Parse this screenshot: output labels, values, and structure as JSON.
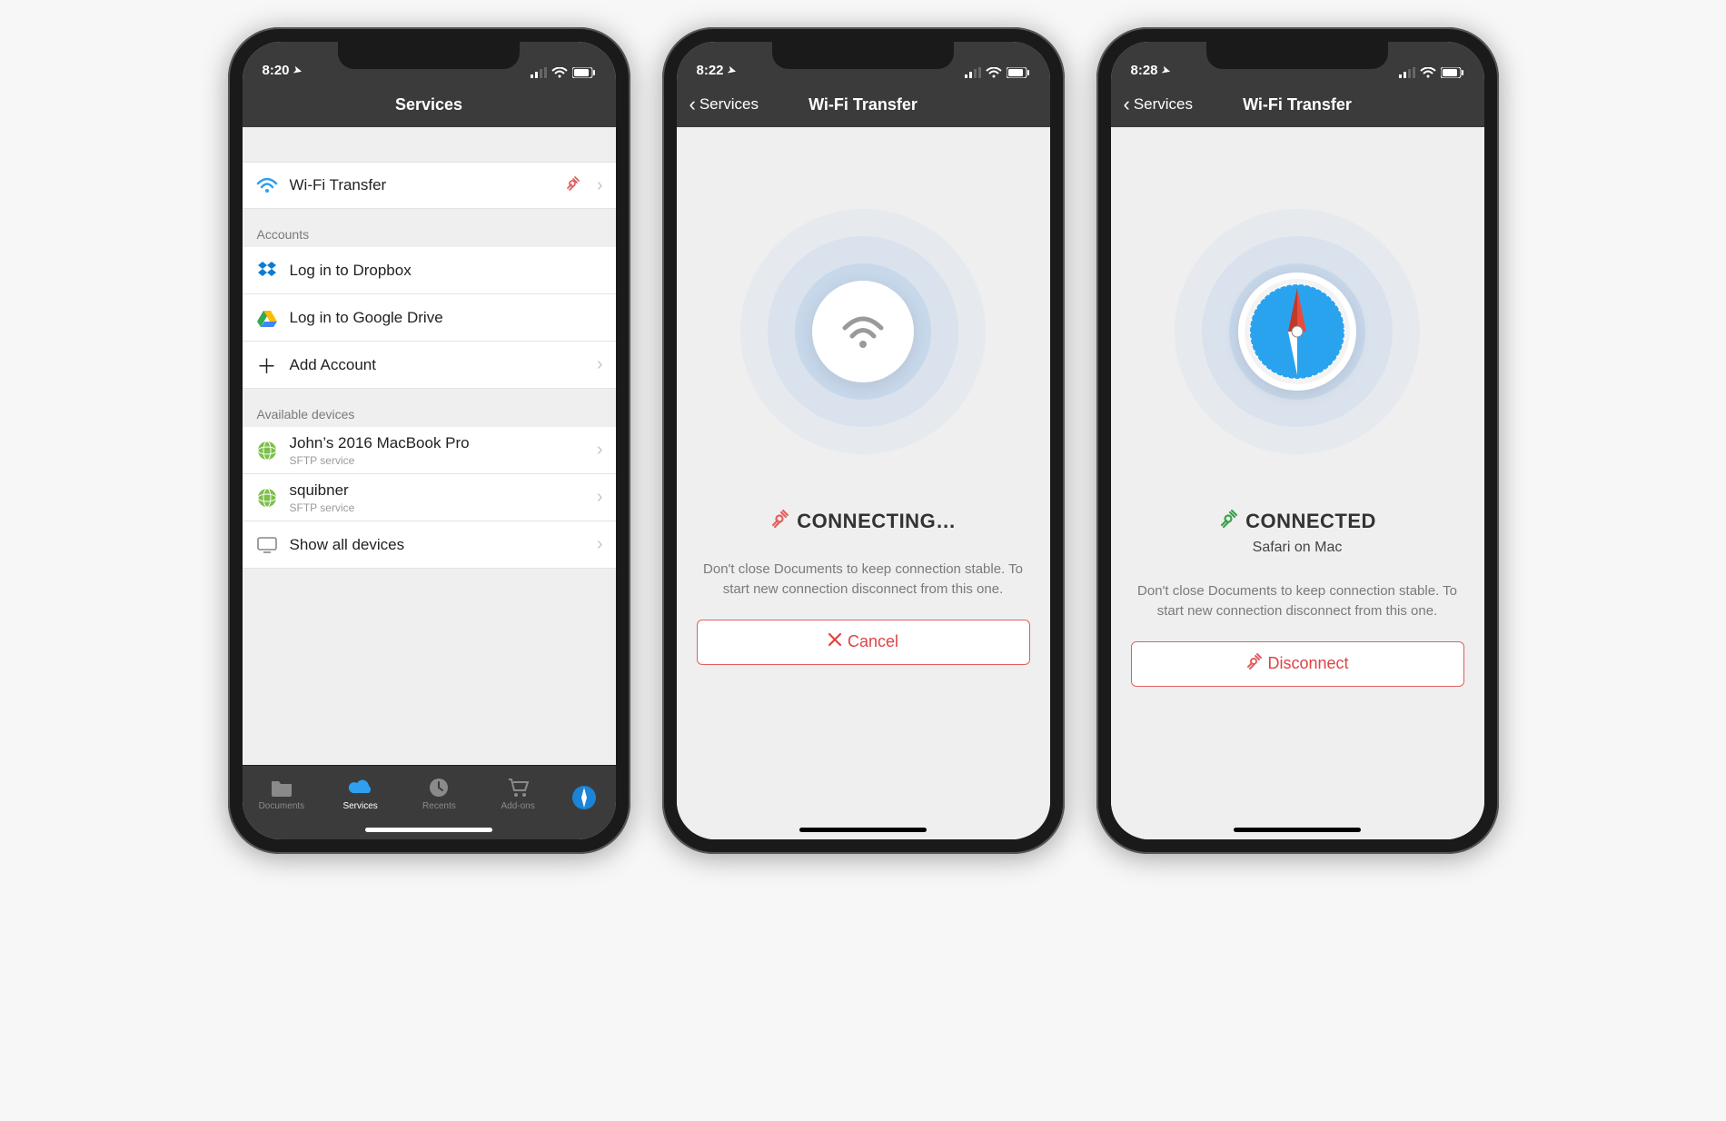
{
  "phones": [
    {
      "status": {
        "time": "8:20",
        "location_icon": true
      },
      "nav": {
        "title": "Services",
        "back": null
      },
      "groups": [
        {
          "header": null,
          "rows": [
            {
              "icon": "wifi",
              "label": "Wi-Fi Transfer",
              "sub": null,
              "trailing_icon": "plug",
              "chevron": true,
              "name": "row-wifi-transfer"
            }
          ]
        },
        {
          "header": "Accounts",
          "rows": [
            {
              "icon": "dropbox",
              "label": "Log in to Dropbox",
              "sub": null,
              "chevron": false,
              "name": "row-dropbox"
            },
            {
              "icon": "gdrive",
              "label": "Log in to Google Drive",
              "sub": null,
              "chevron": false,
              "name": "row-gdrive"
            },
            {
              "icon": "plus",
              "label": "Add Account",
              "sub": null,
              "chevron": true,
              "name": "row-add-account"
            }
          ]
        },
        {
          "header": "Available devices",
          "rows": [
            {
              "icon": "globe",
              "label": "John’s 2016 MacBook Pro",
              "sub": "SFTP service",
              "chevron": true,
              "name": "row-device-johns-mbp"
            },
            {
              "icon": "globe",
              "label": "squibner",
              "sub": "SFTP service",
              "chevron": true,
              "name": "row-device-squibner"
            },
            {
              "icon": "monitor",
              "label": "Show all devices",
              "sub": null,
              "chevron": true,
              "name": "row-show-all-devices"
            }
          ]
        }
      ],
      "tabs": [
        {
          "icon": "folder",
          "label": "Documents",
          "active": false,
          "name": "tab-documents"
        },
        {
          "icon": "cloud",
          "label": "Services",
          "active": true,
          "name": "tab-services"
        },
        {
          "icon": "clock",
          "label": "Recents",
          "active": false,
          "name": "tab-recents"
        },
        {
          "icon": "cart",
          "label": "Add-ons",
          "active": false,
          "name": "tab-addons"
        },
        {
          "icon": "compass",
          "label": "",
          "active": false,
          "name": "tab-browser",
          "compass": true
        }
      ]
    },
    {
      "status": {
        "time": "8:22",
        "location_icon": true
      },
      "nav": {
        "title": "Wi-Fi Transfer",
        "back": "Services"
      },
      "illustration": "wifi",
      "status_icon": "plug-red",
      "status_text": "CONNECTING…",
      "subtext": null,
      "help": "Don't close Documents to keep connection stable. To start new connection disconnect from this one.",
      "button": {
        "icon": "x",
        "label": "Cancel",
        "name": "cancel-button"
      }
    },
    {
      "status": {
        "time": "8:28",
        "location_icon": true
      },
      "nav": {
        "title": "Wi-Fi Transfer",
        "back": "Services"
      },
      "illustration": "safari",
      "status_icon": "plug-green",
      "status_text": "CONNECTED",
      "subtext": "Safari on Mac",
      "help": "Don't close Documents to keep connection stable. To start new connection disconnect from this one.",
      "button": {
        "icon": "plug",
        "label": "Disconnect",
        "name": "disconnect-button"
      }
    }
  ]
}
